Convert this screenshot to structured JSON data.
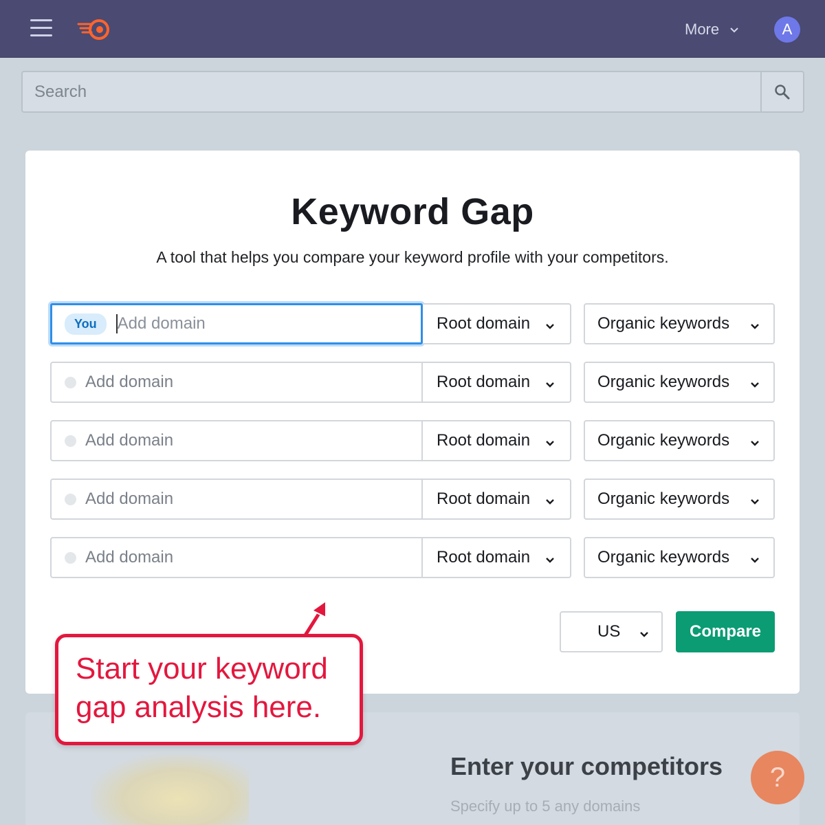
{
  "header": {
    "more_label": "More",
    "avatar_initial": "A"
  },
  "search": {
    "placeholder": "Search"
  },
  "tool": {
    "title": "Keyword Gap",
    "subtitle": "A tool that helps you compare your keyword profile with your competitors.",
    "you_badge": "You",
    "rows": [
      {
        "placeholder": "Add domain",
        "scope": "Root domain",
        "keyword_type": "Organic keywords"
      },
      {
        "placeholder": "Add domain",
        "scope": "Root domain",
        "keyword_type": "Organic keywords"
      },
      {
        "placeholder": "Add domain",
        "scope": "Root domain",
        "keyword_type": "Organic keywords"
      },
      {
        "placeholder": "Add domain",
        "scope": "Root domain",
        "keyword_type": "Organic keywords"
      },
      {
        "placeholder": "Add domain",
        "scope": "Root domain",
        "keyword_type": "Organic keywords"
      }
    ],
    "country": "US",
    "compare_label": "Compare"
  },
  "annotation": {
    "text": "Start your keyword gap analysis here."
  },
  "bottom": {
    "title": "Enter your competitors",
    "subtitle": "Specify up to 5 any domains"
  },
  "help_label": "?",
  "colors": {
    "topbar": "#4a4a72",
    "accent_green": "#0b9c74",
    "focus_blue": "#2f8ee8",
    "callout_red": "#e3173e",
    "logo_orange": "#ff642d"
  }
}
